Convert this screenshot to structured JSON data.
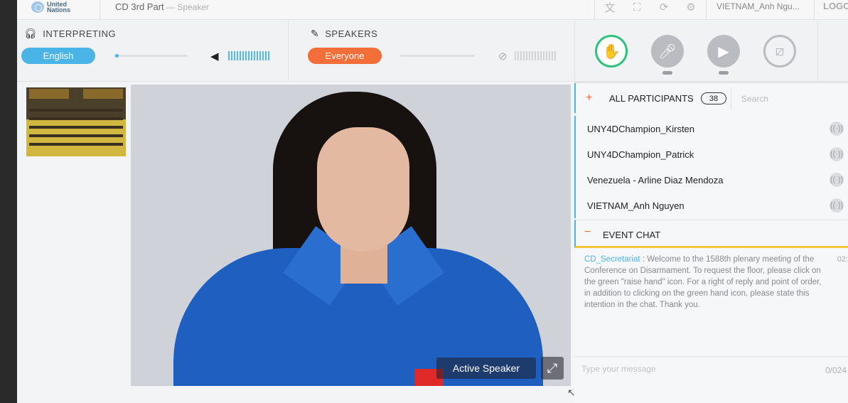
{
  "topbar": {
    "logo_text": "United\nNations",
    "title": "CD 3rd Part",
    "subtitle": " — Speaker",
    "icons": [
      "translate-icon",
      "fullscreen-icon",
      "refresh-icon",
      "settings-icon"
    ],
    "user": "VIETNAM_Anh Ngu...",
    "logout": "LOGO"
  },
  "interpreting": {
    "label": "INTERPRETING",
    "language": "English",
    "volume_level": 0.02
  },
  "speakers": {
    "label": "SPEAKERS",
    "selection": "Everyone",
    "volume_level": 0.0
  },
  "action_buttons": [
    {
      "name": "raise-hand",
      "state": "active"
    },
    {
      "name": "microphone",
      "state": "off"
    },
    {
      "name": "camera",
      "state": "off"
    },
    {
      "name": "screen-share",
      "state": "disabled"
    }
  ],
  "video": {
    "active_speaker_label": "Active Speaker"
  },
  "participants": {
    "title": "ALL PARTICIPANTS",
    "count": "38",
    "search_placeholder": "Search",
    "items": [
      {
        "name": "UNY4DChampion_Kirsten"
      },
      {
        "name": "UNY4DChampion_Patrick"
      },
      {
        "name": "Venezuela - Arline Diaz Mendoza"
      },
      {
        "name": "VIETNAM_Anh Nguyen"
      }
    ]
  },
  "chat": {
    "title": "EVENT CHAT",
    "messages": [
      {
        "sender": "CD_Secretariat",
        "separator": " : ",
        "text": "Welcome to the 1588th plenary meeting of the Conference on Disarmament. To request the floor, please click on the green \"raise hand\" icon. For a right of reply and point of order, in addition to clicking on the green hand icon, please state this intention in the chat. Thank you.",
        "time": "02:"
      }
    ],
    "input_placeholder": "Type your message",
    "char_count": "0/024"
  },
  "colors": {
    "accent_blue": "#4bb4e6",
    "accent_orange": "#f26f3a",
    "raise_hand_green": "#2ec27e",
    "chat_border_yellow": "#f5c540"
  }
}
